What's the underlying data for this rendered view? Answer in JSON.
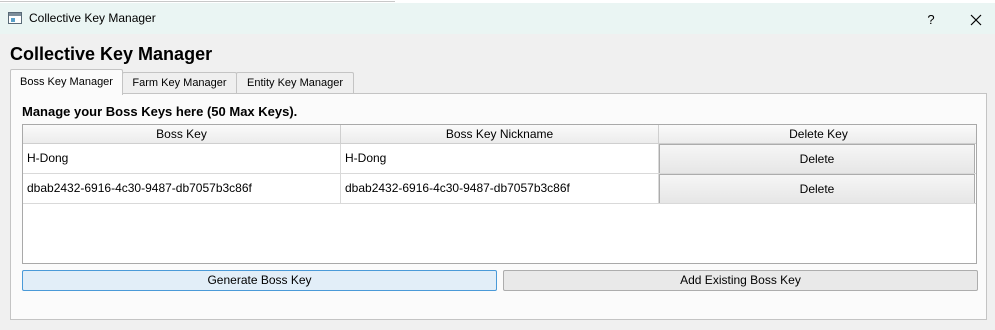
{
  "window": {
    "title": "Collective Key Manager",
    "help_label": "?",
    "close_icon": "close-icon"
  },
  "heading": "Collective Key Manager",
  "tabs": [
    {
      "label": "Boss Key Manager",
      "active": true
    },
    {
      "label": "Farm Key Manager",
      "active": false
    },
    {
      "label": "Entity Key Manager",
      "active": false
    }
  ],
  "panel": {
    "title": "Manage your Boss Keys here (50 Max Keys).",
    "table": {
      "columns": [
        "Boss Key",
        "Boss Key Nickname",
        "Delete Key"
      ],
      "rows": [
        {
          "key": "H-Dong",
          "nickname": "H-Dong",
          "action": "Delete"
        },
        {
          "key": "dbab2432-6916-4c30-9487-db7057b3c86f",
          "nickname": "dbab2432-6916-4c30-9487-db7057b3c86f",
          "action": "Delete"
        }
      ]
    },
    "buttons": {
      "generate": "Generate Boss Key",
      "add_existing": "Add Existing Boss Key"
    }
  },
  "colors": {
    "titlebar_bg": "#eaf5f3",
    "focus_border": "#4a9ad8",
    "panel_bg": "#fbfbfb"
  }
}
